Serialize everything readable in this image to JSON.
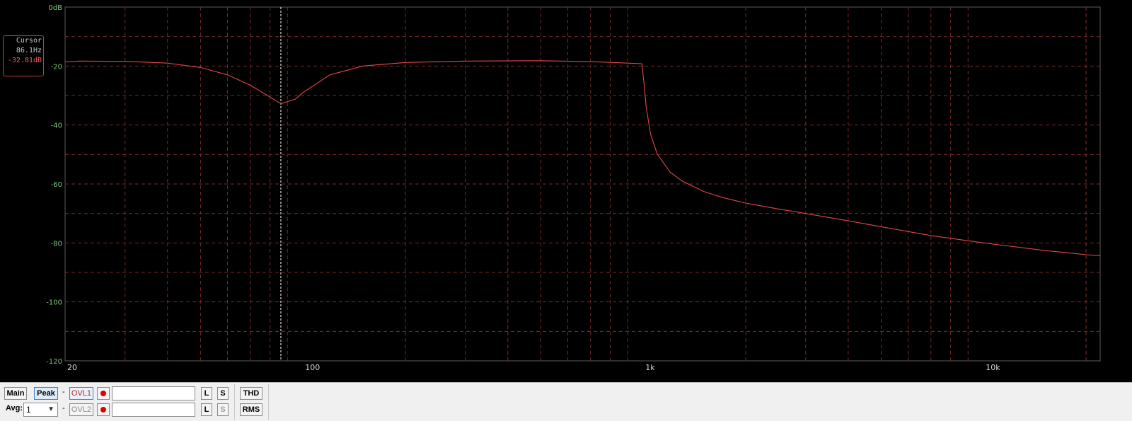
{
  "cursor": {
    "title": "Cursor",
    "frequency": "86.1Hz",
    "level": "-32.81dB"
  },
  "chart_data": {
    "type": "line",
    "x_scale": "log",
    "xlim": [
      20,
      22000
    ],
    "ylim": [
      -120,
      0
    ],
    "x_ticks": [
      {
        "value": 20,
        "label": "20"
      },
      {
        "value": 100,
        "label": "100"
      },
      {
        "value": 1000,
        "label": "1k"
      },
      {
        "value": 10000,
        "label": "10k"
      }
    ],
    "y_ticks": [
      {
        "value": 0,
        "label": "0dB"
      },
      {
        "value": -20,
        "label": "-20"
      },
      {
        "value": -40,
        "label": "-40"
      },
      {
        "value": -60,
        "label": "-60"
      },
      {
        "value": -80,
        "label": "-80"
      },
      {
        "value": -100,
        "label": "-100"
      },
      {
        "value": -120,
        "label": "-120"
      }
    ],
    "grid": true,
    "cursor_x": 86.1,
    "series": [
      {
        "color": "#e04848",
        "x": [
          20,
          22,
          30,
          40,
          50,
          60,
          70,
          80,
          86.1,
          95,
          100,
          120,
          150,
          200,
          300,
          500,
          700,
          900,
          990,
          1005,
          1020,
          1050,
          1100,
          1200,
          1300,
          1500,
          1700,
          2000,
          2500,
          3000,
          4000,
          5000,
          7000,
          10000,
          15000,
          20000,
          22000
        ],
        "y": [
          -18.6,
          -18.3,
          -18.4,
          -19,
          -20.5,
          -23,
          -26.5,
          -30.5,
          -32.81,
          -31.2,
          -29,
          -23,
          -20,
          -18.8,
          -18.3,
          -18.2,
          -18.5,
          -19.0,
          -19.2,
          -26,
          -34,
          -43,
          -50,
          -56,
          -59,
          -62.5,
          -64.5,
          -66.5,
          -68.5,
          -70,
          -72.5,
          -74.5,
          -77.5,
          -80,
          -82.5,
          -84,
          -84.3
        ]
      }
    ]
  },
  "controls": {
    "main_label": "Main",
    "peak_label": "Peak",
    "avg_label": "Avg:",
    "avg_value": "1",
    "dash": "-",
    "ovl1_label": "OVL1",
    "ovl2_label": "OVL2",
    "ovl1_name": "",
    "ovl2_name": "",
    "l_label": "L",
    "s_label": "S",
    "thd_label": "THD",
    "rms_label": "RMS"
  },
  "colors": {
    "trace": "#e04848",
    "grid": "#7a2a2a",
    "y_tick_text": "#7fc87f",
    "x_tick_text": "#d8d8d8",
    "cursor_line": "#ffffff"
  }
}
